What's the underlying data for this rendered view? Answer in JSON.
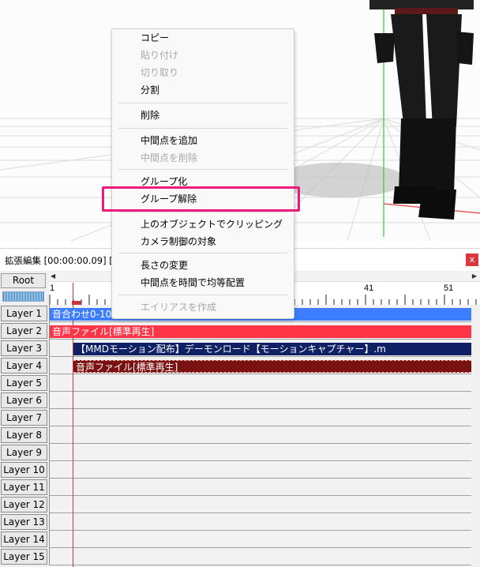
{
  "colors": {
    "accent_highlight": "#ec1a7a",
    "clip_blue": "#3d7dff",
    "clip_red": "#ff3447",
    "clip_navy": "#102064",
    "clip_maroon": "#7a1212",
    "cursor": "#c8383a"
  },
  "context_menu": {
    "items": [
      {
        "label": "コピー",
        "disabled": false
      },
      {
        "label": "貼り付け",
        "disabled": true
      },
      {
        "label": "切り取り",
        "disabled": true
      },
      {
        "label": "分割",
        "disabled": false
      },
      {
        "label": "削除",
        "disabled": false
      },
      {
        "label": "中間点を追加",
        "disabled": false
      },
      {
        "label": "中間点を削除",
        "disabled": true
      },
      {
        "label": "グループ化",
        "disabled": false
      },
      {
        "label": "グループ解除",
        "disabled": false,
        "highlighted": true
      },
      {
        "label": "上のオブジェクトでクリッピング",
        "disabled": false
      },
      {
        "label": "カメラ制御の対象",
        "disabled": false
      },
      {
        "label": "長さの変更",
        "disabled": false
      },
      {
        "label": "中間点を時間で均等配置",
        "disabled": false
      },
      {
        "label": "エイリアスを作成",
        "disabled": true
      }
    ]
  },
  "timeline": {
    "title": "拡張編集 [00:00:00.09] [4",
    "close_label": "x",
    "root_label": "Root",
    "ruler_ticks": [
      "1",
      "41",
      "51"
    ],
    "layers": [
      "Layer 1",
      "Layer 2",
      "Layer 3",
      "Layer 4",
      "Layer 5",
      "Layer 6",
      "Layer 7",
      "Layer 8",
      "Layer 9",
      "Layer 10",
      "Layer 11",
      "Layer 12",
      "Layer 13",
      "Layer 14",
      "Layer 15"
    ],
    "clips": {
      "layer1": "音合わせ0-100",
      "layer2": "音声ファイル[標準再生]",
      "layer3": "【MMDモーション配布】デーモンロード【モーションキャプチャー】.m",
      "layer4": "音声ファイル[標準再生]"
    }
  },
  "icons": {
    "scroll_left": "triangle-left-icon",
    "scroll_right": "triangle-right-icon",
    "close": "close-icon"
  }
}
